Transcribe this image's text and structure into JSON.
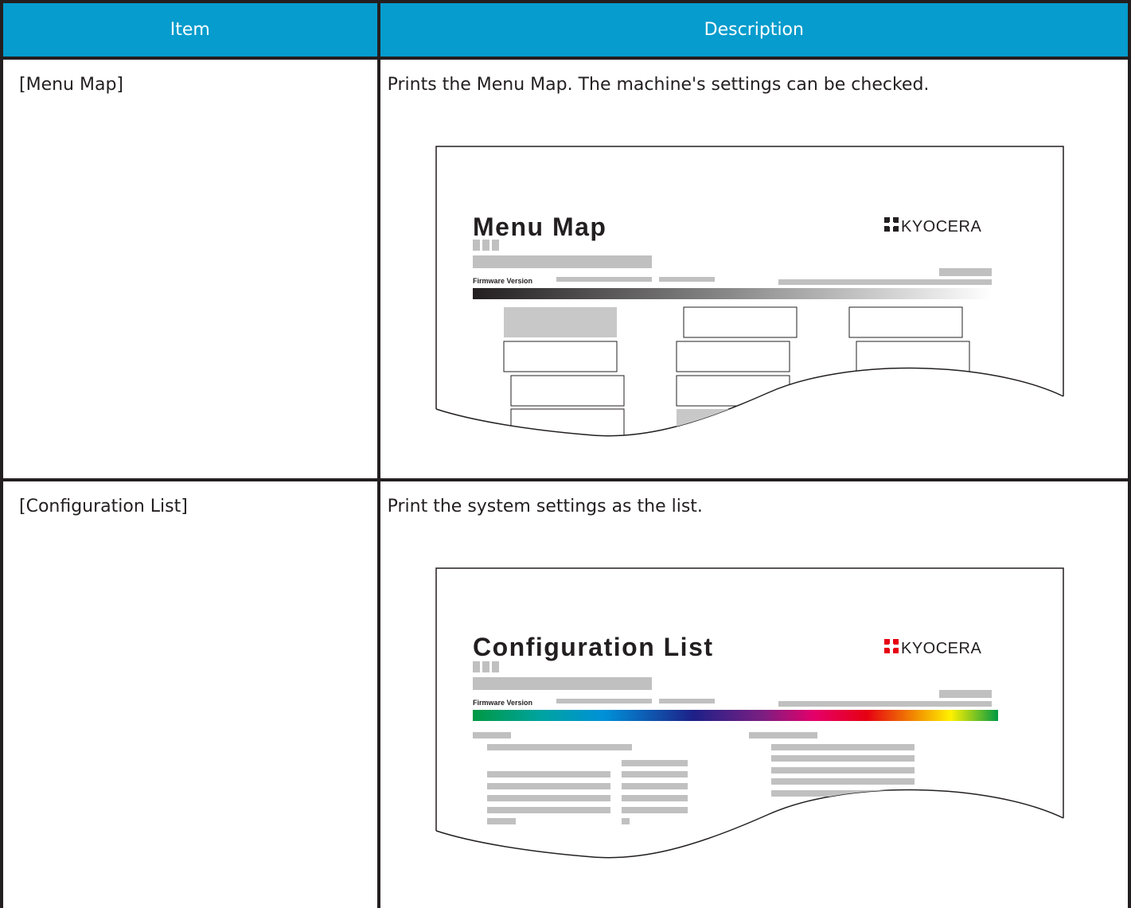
{
  "table": {
    "headers": {
      "item": "Item",
      "description": "Description"
    },
    "rows": [
      {
        "item": "[Menu Map]",
        "description": "Prints the Menu Map. The machine's settings can be checked.",
        "illustration": {
          "title": "Menu Map",
          "logo_text": "KYOCERA",
          "firmware_label": "Firmware Version",
          "bar_style": "grayscale-gradient"
        }
      },
      {
        "item": "[Configuration List]",
        "description": "Print the system settings as the list.",
        "illustration": {
          "title": "Configuration List",
          "logo_text": "KYOCERA",
          "firmware_label": "Firmware Version",
          "bar_style": "rainbow-gradient"
        }
      }
    ]
  },
  "colors": {
    "header_bg": "#069ccd",
    "border": "#231f20",
    "logo_red": "#e60012",
    "placeholder_gray": "#c0c0c0"
  }
}
